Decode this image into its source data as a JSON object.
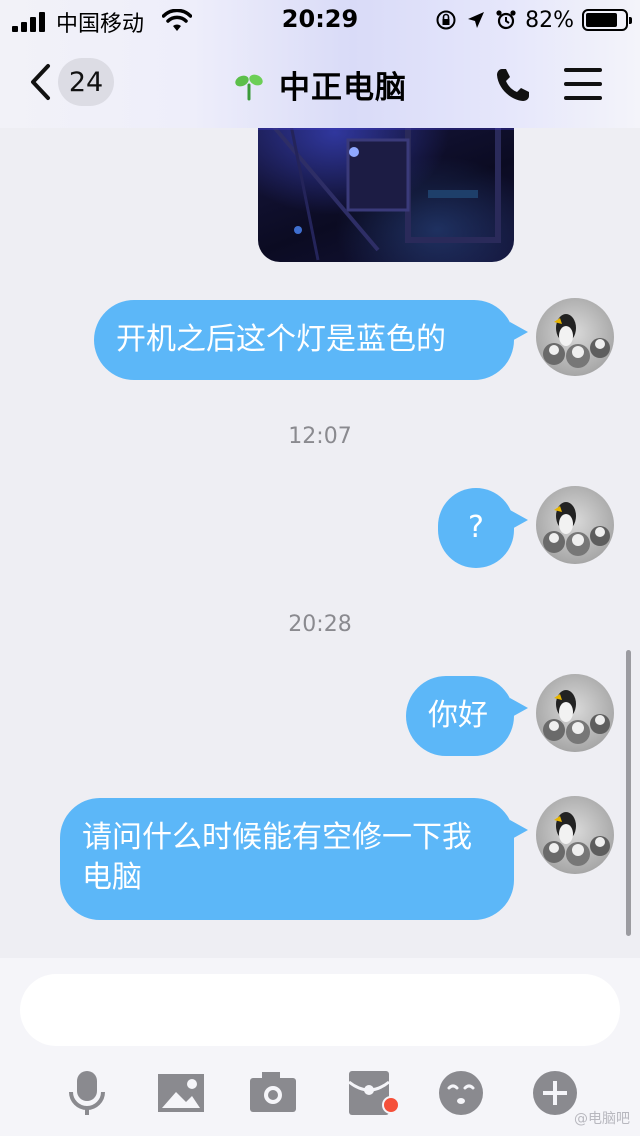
{
  "status_bar": {
    "carrier": "中国移动",
    "time": "20:29",
    "battery_percent": "82%",
    "battery_level": 0.82
  },
  "nav": {
    "unread_count": "24",
    "title": "中正电脑"
  },
  "messages": [
    {
      "type": "image",
      "sender": "me"
    },
    {
      "type": "text",
      "sender": "me",
      "text": "开机之后这个灯是蓝色的"
    },
    {
      "type": "time",
      "text": "12:07"
    },
    {
      "type": "text",
      "sender": "me",
      "text": "?"
    },
    {
      "type": "time",
      "text": "20:28"
    },
    {
      "type": "text",
      "sender": "me",
      "text": "你好"
    },
    {
      "type": "text",
      "sender": "me",
      "text": "请问什么时候能有空修一下我电脑"
    }
  ],
  "input": {
    "value": "",
    "placeholder": ""
  },
  "toolbar": {
    "icons": [
      "microphone-icon",
      "image-icon",
      "camera-icon",
      "red-packet-icon",
      "emoji-icon",
      "plus-icon"
    ],
    "red_packet_has_badge": true
  },
  "watermark": "@电脑吧",
  "colors": {
    "bubble": "#5cb7f8",
    "background": "#eeeef3",
    "badge": "#f5503a",
    "icon": "#8a8a8f"
  }
}
